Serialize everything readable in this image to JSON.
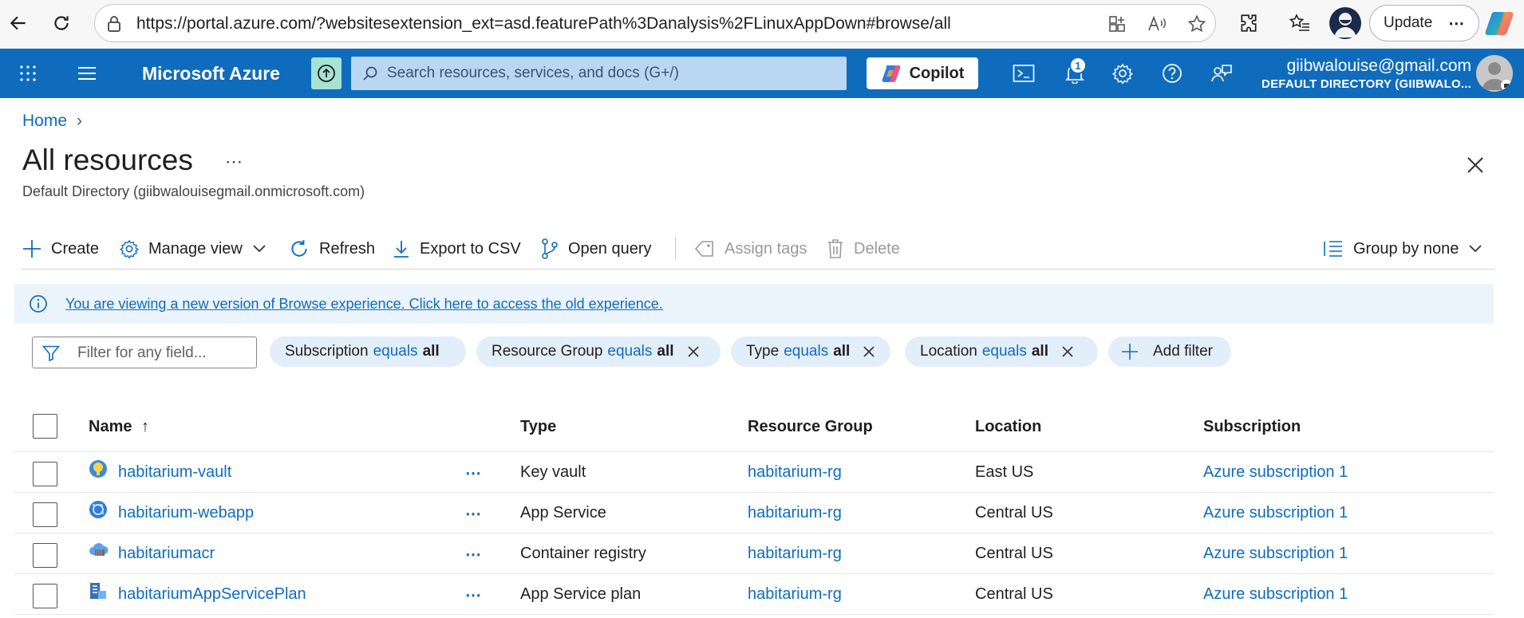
{
  "browser": {
    "url": "https://portal.azure.com/?websitesextension_ext=asd.featurePath%3Danalysis%2FLinuxAppDown#browse/all",
    "update_label": "Update",
    "update_more": "⋯"
  },
  "header": {
    "brand": "Microsoft Azure",
    "search_placeholder": "Search resources, services, and docs (G+/)",
    "copilot_label": "Copilot",
    "notification_count": "1",
    "account_email": "giibwalouise@gmail.com",
    "account_directory": "DEFAULT DIRECTORY (GIIBWALO..."
  },
  "breadcrumb": {
    "home": "Home",
    "separator": "›"
  },
  "page": {
    "title": "All resources",
    "more": "⋯",
    "subtitle": "Default Directory (giibwalouisegmail.onmicrosoft.com)"
  },
  "toolbar": {
    "create": "Create",
    "manage_view": "Manage view",
    "refresh": "Refresh",
    "export_csv": "Export to CSV",
    "open_query": "Open query",
    "assign_tags": "Assign tags",
    "delete": "Delete",
    "group_by": "Group by none"
  },
  "banner": {
    "text": "You are viewing a new version of Browse experience. Click here to access the old experience."
  },
  "filters": {
    "placeholder": "Filter for any field...",
    "pills": [
      {
        "field": "Subscription",
        "op": "equals",
        "value": "all"
      },
      {
        "field": "Resource Group",
        "op": "equals",
        "value": "all"
      },
      {
        "field": "Type",
        "op": "equals",
        "value": "all"
      },
      {
        "field": "Location",
        "op": "equals",
        "value": "all"
      }
    ],
    "add_filter": "Add filter"
  },
  "table": {
    "columns": {
      "name": "Name",
      "sort_indicator": "↑",
      "type": "Type",
      "resource_group": "Resource Group",
      "location": "Location",
      "subscription": "Subscription"
    },
    "row_more": "⋯",
    "rows": [
      {
        "icon": "key-vault-icon",
        "name": "habitarium-vault",
        "type": "Key vault",
        "resource_group": "habitarium-rg",
        "location": "East US",
        "subscription": "Azure subscription 1"
      },
      {
        "icon": "app-service-icon",
        "name": "habitarium-webapp",
        "type": "App Service",
        "resource_group": "habitarium-rg",
        "location": "Central US",
        "subscription": "Azure subscription 1"
      },
      {
        "icon": "container-registry-icon",
        "name": "habitariumacr",
        "type": "Container registry",
        "resource_group": "habitarium-rg",
        "location": "Central US",
        "subscription": "Azure subscription 1"
      },
      {
        "icon": "app-service-plan-icon",
        "name": "habitariumAppServicePlan",
        "type": "App Service plan",
        "resource_group": "habitarium-rg",
        "location": "Central US",
        "subscription": "Azure subscription 1"
      }
    ]
  },
  "colors": {
    "azure_blue": "#0f6cbd",
    "link": "#0f6cbd",
    "banner_bg": "#ebf3fc",
    "pill_bg": "#e3eefb"
  }
}
